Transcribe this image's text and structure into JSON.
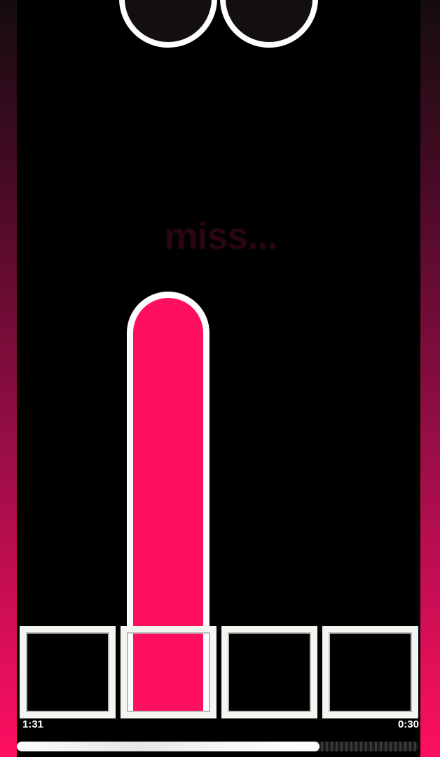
{
  "game": {
    "judgement_text": "miss...",
    "elapsed_time": "1:31",
    "remaining_time": "0:30",
    "progress_fraction": 0.752,
    "lane_count": 4,
    "hold_note_lane": 2,
    "incoming_circle_notes_lanes": [
      2,
      3
    ]
  },
  "colors": {
    "accent": "#ff0f62",
    "background": "#000000",
    "receptor": "#f4f4f1",
    "note_border": "#ffffff"
  }
}
